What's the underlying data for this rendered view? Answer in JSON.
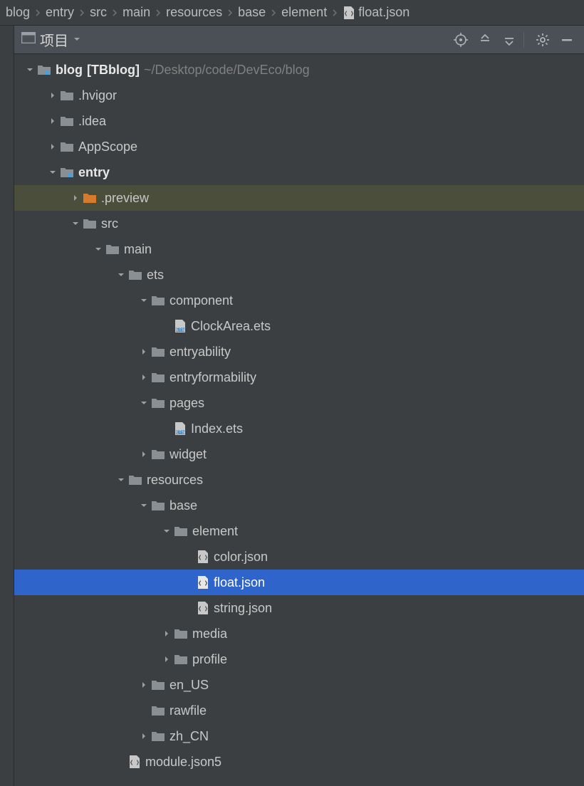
{
  "breadcrumbs": [
    {
      "label": "blog"
    },
    {
      "label": "entry"
    },
    {
      "label": "src"
    },
    {
      "label": "main"
    },
    {
      "label": "resources"
    },
    {
      "label": "base"
    },
    {
      "label": "element"
    },
    {
      "label": "float.json",
      "icon": "json"
    }
  ],
  "paneHeader": {
    "title": "项目"
  },
  "tree": {
    "root": {
      "name": "blog",
      "bracket": "[TBblog]",
      "path": "~/Desktop/code/DevEco/blog"
    },
    "items": [
      {
        "label": ".hvigor",
        "depth": 1,
        "arrow": "right",
        "icon": "folder"
      },
      {
        "label": ".idea",
        "depth": 1,
        "arrow": "right",
        "icon": "folder"
      },
      {
        "label": "AppScope",
        "depth": 1,
        "arrow": "right",
        "icon": "folder"
      },
      {
        "label": "entry",
        "depth": 1,
        "arrow": "down",
        "icon": "module",
        "bold": true
      },
      {
        "label": ".preview",
        "depth": 2,
        "arrow": "right",
        "icon": "folder-orange",
        "rowStyle": "hover"
      },
      {
        "label": "src",
        "depth": 2,
        "arrow": "down",
        "icon": "folder"
      },
      {
        "label": "main",
        "depth": 3,
        "arrow": "down",
        "icon": "folder"
      },
      {
        "label": "ets",
        "depth": 4,
        "arrow": "down",
        "icon": "folder"
      },
      {
        "label": "component",
        "depth": 5,
        "arrow": "down",
        "icon": "folder"
      },
      {
        "label": "ClockArea.ets",
        "depth": 6,
        "arrow": "none",
        "icon": "ets"
      },
      {
        "label": "entryability",
        "depth": 5,
        "arrow": "right",
        "icon": "folder"
      },
      {
        "label": "entryformability",
        "depth": 5,
        "arrow": "right",
        "icon": "folder"
      },
      {
        "label": "pages",
        "depth": 5,
        "arrow": "down",
        "icon": "folder"
      },
      {
        "label": "Index.ets",
        "depth": 6,
        "arrow": "none",
        "icon": "ets"
      },
      {
        "label": "widget",
        "depth": 5,
        "arrow": "right",
        "icon": "folder"
      },
      {
        "label": "resources",
        "depth": 4,
        "arrow": "down",
        "icon": "folder"
      },
      {
        "label": "base",
        "depth": 5,
        "arrow": "down",
        "icon": "folder"
      },
      {
        "label": "element",
        "depth": 6,
        "arrow": "down",
        "icon": "folder"
      },
      {
        "label": "color.json",
        "depth": 7,
        "arrow": "none",
        "icon": "json"
      },
      {
        "label": "float.json",
        "depth": 7,
        "arrow": "none",
        "icon": "json",
        "rowStyle": "selected"
      },
      {
        "label": "string.json",
        "depth": 7,
        "arrow": "none",
        "icon": "json"
      },
      {
        "label": "media",
        "depth": 6,
        "arrow": "right",
        "icon": "folder"
      },
      {
        "label": "profile",
        "depth": 6,
        "arrow": "right",
        "icon": "folder"
      },
      {
        "label": "en_US",
        "depth": 5,
        "arrow": "right",
        "icon": "folder"
      },
      {
        "label": "rawfile",
        "depth": 5,
        "arrow": "none",
        "icon": "folder"
      },
      {
        "label": "zh_CN",
        "depth": 5,
        "arrow": "right",
        "icon": "folder"
      },
      {
        "label": "module.json5",
        "depth": 4,
        "arrow": "none",
        "icon": "json"
      }
    ]
  }
}
